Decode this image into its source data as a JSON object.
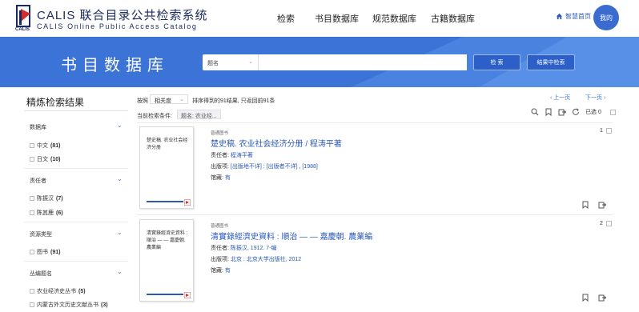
{
  "header": {
    "logo_cn": "CALIS 联合目录公共检索系统",
    "logo_en": "CALIS Online Public Access Catalog",
    "logo_small": "CALIS",
    "nav": [
      "检索",
      "书目数据库",
      "规范数据库",
      "古籍数据库"
    ],
    "home_link": "智慧首页",
    "avatar_label": "我的"
  },
  "banner": {
    "title": "书目数据库",
    "search_field": "题名",
    "search_value": "",
    "search_button": "检 索",
    "within_button": "结果中检索"
  },
  "sidebar": {
    "title": "精炼检索结果",
    "facets": [
      {
        "label": "数据库",
        "items": [
          {
            "name": "中文",
            "count": "(81)"
          },
          {
            "name": "日文",
            "count": "(10)"
          }
        ]
      },
      {
        "label": "责任者",
        "items": [
          {
            "name": "陈振汉",
            "count": "(7)"
          },
          {
            "name": "陈其鹿",
            "count": "(6)"
          }
        ]
      },
      {
        "label": "资源类型",
        "items": [
          {
            "name": "图书",
            "count": "(91)"
          }
        ]
      },
      {
        "label": "丛编题名",
        "items": [
          {
            "name": "农业经济史丛书",
            "count": "(5)"
          },
          {
            "name": "内蒙古外文历史文献丛书",
            "count": "(3)"
          }
        ]
      }
    ]
  },
  "results": {
    "sort_label": "按照",
    "sort_value": "相关度",
    "sort_info": "排序得到的91结果, 只返回前91条",
    "prev": "上一页",
    "next": "下一页",
    "cond_label": "当前检索条件:",
    "cond_value": "题名: 农业经...",
    "selected": "已选 0",
    "records": [
      {
        "num": "1",
        "type": "普通图书",
        "title": "楚史稿. 农业社会经济分册 / 程涛平著",
        "cover_text": "楚史稿. 农业社会经济分册",
        "resp_label": "责任者:",
        "resp": "程涛平著",
        "pub_label": "出版项:",
        "pub": "[出版地不详] : [出版者不详] , [1988]",
        "hold_label": "馆藏:",
        "hold": "有"
      },
      {
        "num": "2",
        "type": "普通图书",
        "title": "清實錄經濟史資料 : 順治 — — 嘉慶朝. 農業編",
        "cover_text": "清實錄經濟史資料 : 順治 — — 嘉慶朝. 農業編",
        "resp_label": "责任者:",
        "resp": "陈振汉, 1912. 7-编",
        "pub_label": "出版项:",
        "pub": "北京 : 北京大学出版社, 2012",
        "hold_label": "馆藏:",
        "hold": "有"
      }
    ]
  },
  "colors": {
    "accent": "#3b74d6",
    "link": "#2b59b8",
    "logo_red": "#d52b2b"
  }
}
